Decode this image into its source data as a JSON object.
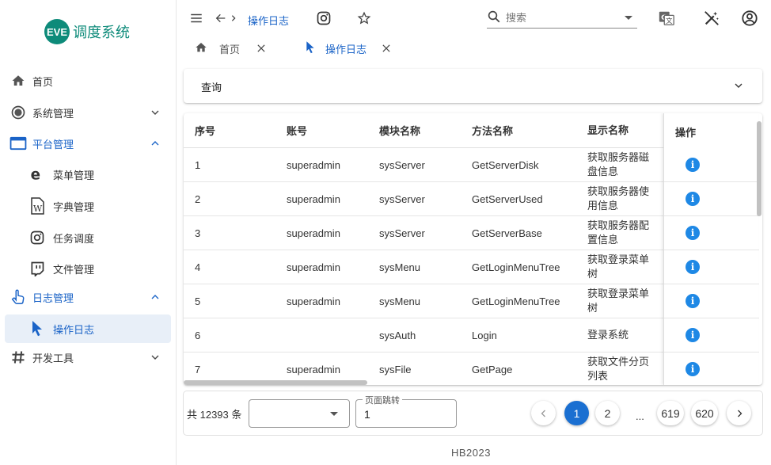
{
  "app": {
    "logo_badge": "EVE",
    "logo_text": "调度系统"
  },
  "sidebar": {
    "items": [
      {
        "label": "首页",
        "icon": "home-icon"
      },
      {
        "label": "系统管理",
        "icon": "settings-circle-icon"
      },
      {
        "label": "平台管理",
        "icon": "window-icon"
      },
      {
        "label": "菜单管理",
        "icon": "edge-icon"
      },
      {
        "label": "字典管理",
        "icon": "word-doc-icon"
      },
      {
        "label": "任务调度",
        "icon": "instagram-icon"
      },
      {
        "label": "文件管理",
        "icon": "twitch-icon"
      },
      {
        "label": "日志管理",
        "icon": "pointer-hand-icon"
      },
      {
        "label": "操作日志",
        "icon": "cursor-icon"
      },
      {
        "label": "开发工具",
        "icon": "hash-icon"
      }
    ]
  },
  "topbar": {
    "breadcrumb": "操作日志",
    "search_placeholder": "搜索"
  },
  "tabs": [
    {
      "label": "首页"
    },
    {
      "label": "操作日志"
    }
  ],
  "query": {
    "title": "查询"
  },
  "table": {
    "headers": [
      "序号",
      "账号",
      "模块名称",
      "方法名称",
      "显示名称",
      "操作"
    ],
    "rows": [
      {
        "no": "1",
        "account": "superadmin",
        "module": "sysServer",
        "method": "GetServerDisk",
        "display": "获取服务器磁盘信息"
      },
      {
        "no": "2",
        "account": "superadmin",
        "module": "sysServer",
        "method": "GetServerUsed",
        "display": "获取服务器使用信息"
      },
      {
        "no": "3",
        "account": "superadmin",
        "module": "sysServer",
        "method": "GetServerBase",
        "display": "获取服务器配置信息"
      },
      {
        "no": "4",
        "account": "superadmin",
        "module": "sysMenu",
        "method": "GetLoginMenuTree",
        "display": "获取登录菜单树"
      },
      {
        "no": "5",
        "account": "superadmin",
        "module": "sysMenu",
        "method": "GetLoginMenuTree",
        "display": "获取登录菜单树"
      },
      {
        "no": "6",
        "account": "",
        "module": "sysAuth",
        "method": "Login",
        "display": "登录系统"
      },
      {
        "no": "7",
        "account": "superadmin",
        "module": "sysFile",
        "method": "GetPage",
        "display": "获取文件分页列表"
      }
    ],
    "action_icon": "i"
  },
  "pager": {
    "total": "共 12393 条",
    "jump_label": "页面跳转",
    "jump_value": "1",
    "pages": [
      "1",
      "2",
      "619",
      "620"
    ],
    "ellipsis": "..."
  },
  "footer": "HB2023",
  "colors": {
    "brand": "#0e8b7a",
    "accent": "#1a63c7",
    "active_page": "#1a6fd1"
  }
}
